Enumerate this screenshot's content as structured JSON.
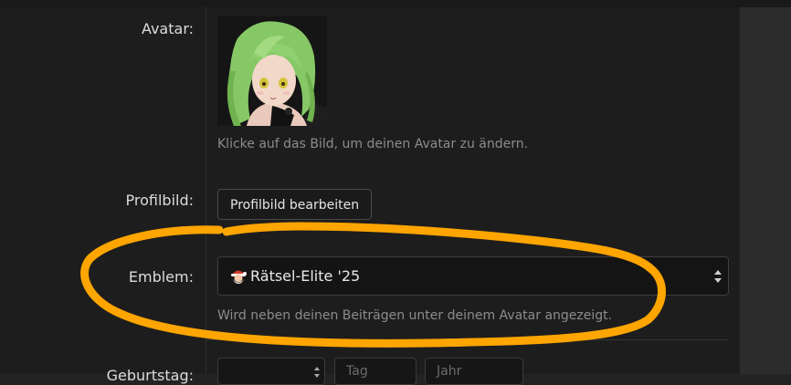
{
  "avatar": {
    "label": "Avatar:",
    "hint": "Klicke auf das Bild, um deinen Avatar zu ändern."
  },
  "profile_image": {
    "label": "Profilbild:",
    "button_label": "Profilbild bearbeiten"
  },
  "emblem": {
    "label": "Emblem:",
    "selected_value": "Rätsel-Elite '25",
    "icon": "santa-emoji-icon",
    "hint": "Wird neben deinen Beiträgen unter deinem Avatar angezeigt."
  },
  "birthday": {
    "label": "Geburtstag:",
    "placeholders": [
      "Tag",
      "Jahr"
    ]
  },
  "colors": {
    "highlight": "#FFA500",
    "background": "#1d1d1d"
  }
}
